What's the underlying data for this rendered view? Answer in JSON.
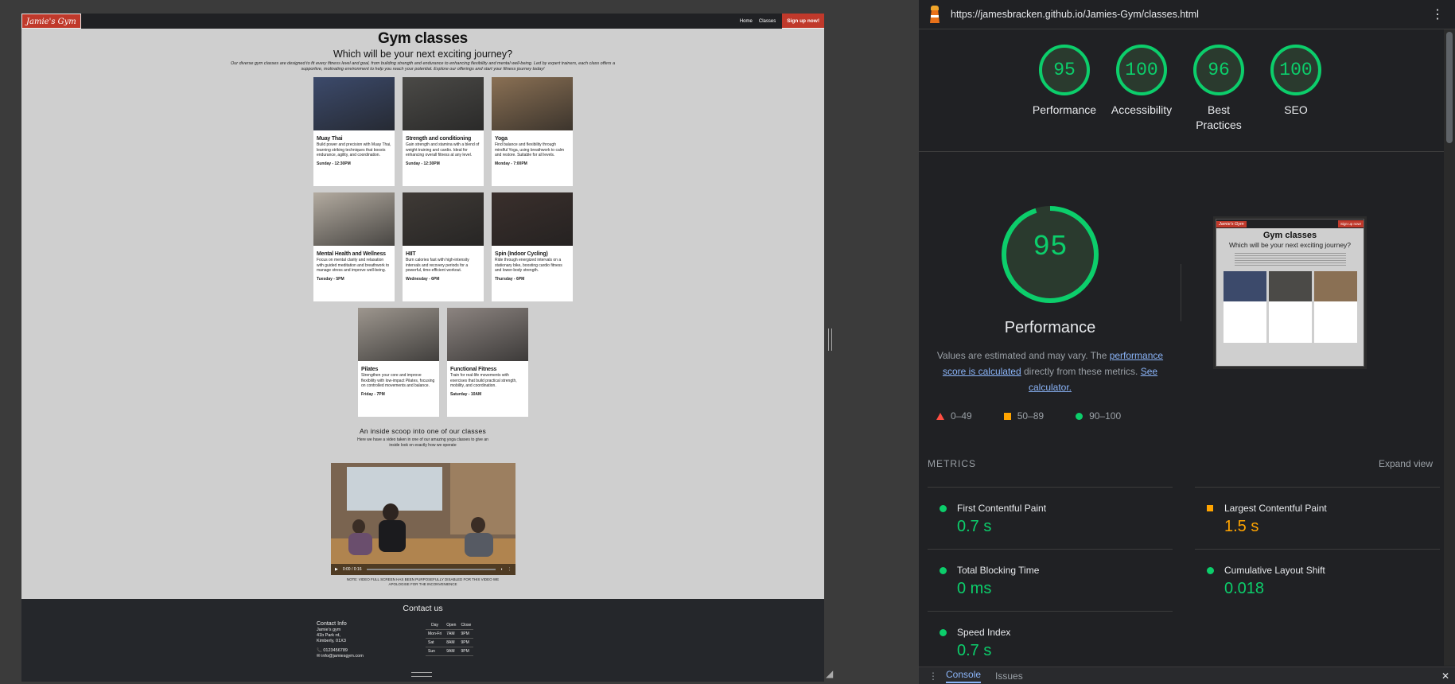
{
  "site": {
    "logo": "Jamie's Gym",
    "nav": [
      "Home",
      "Classes"
    ],
    "cta": "Sign up now!",
    "title": "Gym classes",
    "subtitle": "Which will be your next exciting journey?",
    "intro": "Our diverse gym classes are designed to fit every fitness level and goal, from building strength and endurance to enhancing flexibility and mental well-being. Led by expert trainers, each class offers a supportive, motivating environment to help you reach your potential. Explore our offerings and start your fitness journey today!",
    "classes": [
      {
        "title": "Muay Thai",
        "desc": "Build power and precision with Muay Thai, learning striking techniques that boosts endurance, agility, and coordination.",
        "time": "Sunday - 12:30PM",
        "img": "#3c4a6b"
      },
      {
        "title": "Strength and conditioning",
        "desc": "Gain strength and stamina with a blend of weight training and cardio. Ideal for enhancing overall fitness at any level.",
        "time": "Sunday - 12:30PM",
        "img": "#4b4a47"
      },
      {
        "title": "Yoga",
        "desc": "Find balance and flexibility through mindful Yoga, using breathwork to calm and restore. Suitable for all levels.",
        "time": "Monday - 7:00PM",
        "img": "#8a7054"
      },
      {
        "title": "Mental Health and Wellness",
        "desc": "Focus on mental clarity and relaxation with guided meditation and breathwork to manage stress and improve well-being.",
        "time": "Tuesday - 5PM",
        "img": "#b3aba0"
      },
      {
        "title": "HIIT",
        "desc": "Burn calories fast with high-intensity intervals and recovery periods for a powerful, time-efficient workout.",
        "time": "Wednesday - 6PM",
        "img": "#3f3a36"
      },
      {
        "title": "Spin (Indoor Cycling)",
        "desc": "Ride through energized intervals on a stationary bike, boosting cardio fitness and lower-body strength.",
        "time": "Thursday - 6PM",
        "img": "#3a2f2c"
      },
      {
        "title": "Pilates",
        "desc": "Strengthen your core and improve flexibility with low-impact Pilates, focusing on controlled movements and balance.",
        "time": "Friday - 7PM",
        "img": "#9d968e"
      },
      {
        "title": "Functional Fitness",
        "desc": "Train for real-life movements with exercises that build practical strength, mobility, and coordination.",
        "time": "Saturday - 10AM",
        "img": "#8c8480"
      }
    ],
    "scoop_title": "An inside scoop into one of our classes",
    "scoop_sub": "Here we have a video taken in one of our amazing yoga classes to give an inside look on exactly how we operate",
    "video_time": "0:00 / 0:16",
    "video_note": "NOTE: VIDEO FULL SCREEN HAS BEEN PURPOSEFULLY DISABLED FOR THIS VIDEO WE APOLOGISE FOR THE INCONVENIENCE",
    "footer": {
      "title": "Contact us",
      "info_head": "Contact Info",
      "address": [
        "Jamie's gym",
        "41b Park rd,",
        "Kimberly, 01X3"
      ],
      "phone": "📞 0123456789",
      "email": "✉ info@jamiesgym.com",
      "hours_head": [
        "Day",
        "Open",
        "Close"
      ],
      "hours": [
        [
          "Mon-Fri",
          "7AM",
          "9PM"
        ],
        [
          "Sat",
          "8AM",
          "9PM"
        ],
        [
          "Sun",
          "9AM",
          "9PM"
        ]
      ]
    }
  },
  "devtools": {
    "url": "https://jamesbracken.github.io/Jamies-Gym/classes.html",
    "categories": [
      {
        "label": "Performance",
        "score": "95"
      },
      {
        "label": "Accessibility",
        "score": "100"
      },
      {
        "label": "Best Practices",
        "score": "96"
      },
      {
        "label": "SEO",
        "score": "100"
      }
    ],
    "main_score": "95",
    "main_title": "Performance",
    "desc_pre": "Values are estimated and may vary. The ",
    "desc_link1": "performance score is calculated",
    "desc_mid": " directly from these metrics. ",
    "desc_link2": "See calculator.",
    "legend": [
      "0–49",
      "50–89",
      "90–100"
    ],
    "metrics_head": "METRICS",
    "expand": "Expand view",
    "metrics": [
      {
        "name": "First Contentful Paint",
        "value": "0.7 s",
        "status": "good"
      },
      {
        "name": "Largest Contentful Paint",
        "value": "1.5 s",
        "status": "average"
      },
      {
        "name": "Total Blocking Time",
        "value": "0 ms",
        "status": "good"
      },
      {
        "name": "Cumulative Layout Shift",
        "value": "0.018",
        "status": "good"
      },
      {
        "name": "Speed Index",
        "value": "0.7 s",
        "status": "good"
      }
    ],
    "drawer_tabs": [
      "Console",
      "Issues"
    ],
    "colors": {
      "good": "#0cce6b",
      "average": "#ffa400",
      "poor": "#ff4e42"
    }
  }
}
